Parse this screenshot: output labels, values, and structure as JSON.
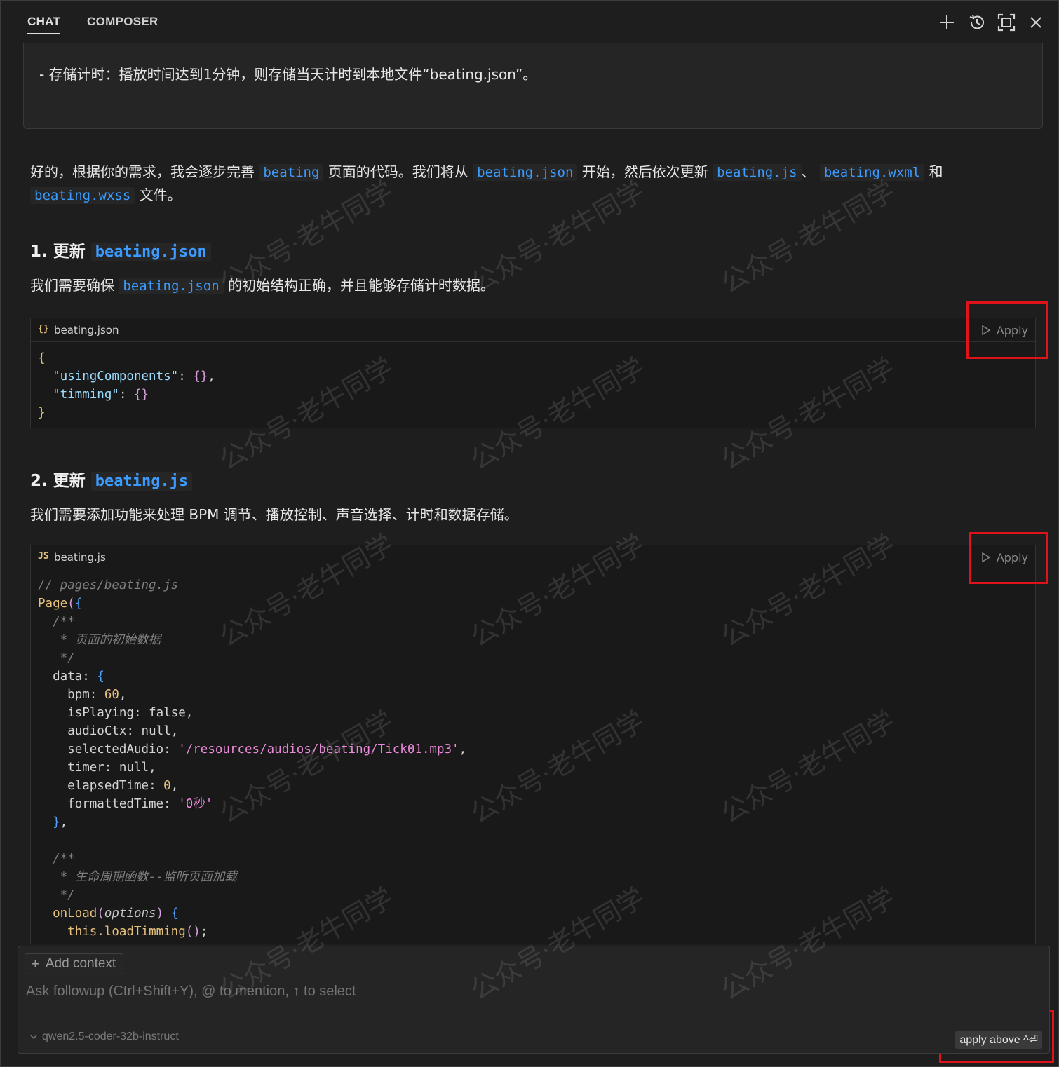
{
  "tabs": [
    {
      "label": "CHAT",
      "active": true
    },
    {
      "label": "COMPOSER",
      "active": false
    }
  ],
  "toolbar_icons": [
    "plus-icon",
    "history-icon",
    "maximize-icon",
    "close-icon"
  ],
  "user_message": "- 存储计时：播放时间达到1分钟，则存储当天计时到本地文件“beating.json”。",
  "intro": {
    "t1": "好的，根据你的需求，我会逐步完善",
    "c1": "beating",
    "t2": "页面的代码。我们将从",
    "c2": "beating.json",
    "t3": "开始，然后依次更新",
    "c3": "beating.js",
    "t4": "、",
    "c4": "beating.wxml",
    "t5": "和",
    "c5": "beating.wxss",
    "t6": "文件。"
  },
  "section1": {
    "heading_prefix": "1. 更新",
    "heading_code": "beating.json",
    "desc_pre": "我们需要确保",
    "desc_code": "beating.json",
    "desc_post": "的初始结构正确，并且能够存储计时数据。",
    "code_icon": "{}",
    "filename": "beating.json",
    "apply_label": "Apply"
  },
  "section2": {
    "heading_prefix": "2. 更新",
    "heading_code": "beating.js",
    "desc": "我们需要添加功能来处理 BPM 调节、播放控制、声音选择、计时和数据存储。",
    "code_icon": "JS",
    "filename": "beating.js",
    "apply_label": "Apply"
  },
  "json_code": {
    "open": "{",
    "k1": "\"usingComponents\"",
    "v1": "{}",
    "k2": "\"timming\"",
    "v2": "{}",
    "close": "}"
  },
  "js_code": {
    "comment_file": "// pages/beating.js",
    "page": "Page",
    "cm_open": "/**",
    "cm_data": " * 页面的初始数据",
    "cm_close": " */",
    "data": "data",
    "bpm_key": "bpm",
    "bpm_val": "60",
    "isPlaying_key": "isPlaying",
    "isPlaying_val": "false",
    "audioCtx_key": "audioCtx",
    "audioCtx_val": "null",
    "selectedAudio_key": "selectedAudio",
    "selectedAudio_val": "'/resources/audios/beating/Tick01.mp3'",
    "timer_key": "timer",
    "timer_val": "null",
    "elapsedTime_key": "elapsedTime",
    "elapsedTime_val": "0",
    "formattedTime_key": "formattedTime",
    "formattedTime_val": "'0秒'",
    "cm_lifecycle": " * 生命周期函数--监听页面加载",
    "onLoad": "onLoad",
    "onLoad_param": "options",
    "this_kw": "this",
    "loadTimming": ".loadTimming"
  },
  "input": {
    "add_context": "Add context",
    "placeholder": "Ask followup (Ctrl+Shift+Y), @ to mention, ↑ to select",
    "model": "qwen2.5-coder-32b-instruct",
    "apply_above": "apply above ^⏎"
  },
  "watermark": "公众号·老牛同学",
  "colors": {
    "background": "#1e1e1e",
    "inline_code": "#3b9bff",
    "highlight_box": "#e0131a"
  }
}
